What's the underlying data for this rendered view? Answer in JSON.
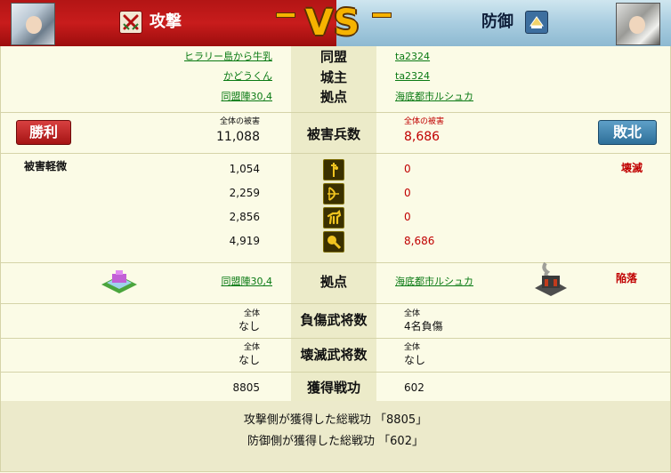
{
  "header": {
    "attack_label": "攻撃",
    "defense_label": "防御",
    "vs_text": "VS",
    "attack_color": "#c81c1c",
    "defense_color": "#a9cde0"
  },
  "info_rows": [
    {
      "label": "同盟",
      "attacker": "ヒラリー島から牛乳",
      "defender": "ta2324"
    },
    {
      "label": "城主",
      "attacker": "かどうくん",
      "defender": "ta2324"
    },
    {
      "label": "拠点",
      "attacker": "同盟陣30,4",
      "defender": "海底都市ルシュカ"
    }
  ],
  "damage": {
    "label": "被害兵数",
    "attacker_caption": "全体の被害",
    "attacker_total": "11,088",
    "defender_caption": "全体の被害",
    "defender_total": "8,686",
    "attacker_result": "勝利",
    "defender_result": "敗北",
    "attacker_status": "被害軽微",
    "defender_status": "壊滅"
  },
  "units": [
    {
      "icon": "spearman-icon",
      "attacker": "1,054",
      "defender": "0"
    },
    {
      "icon": "archer-icon",
      "attacker": "2,259",
      "defender": "0"
    },
    {
      "icon": "cavalry-icon",
      "attacker": "2,856",
      "defender": "0"
    },
    {
      "icon": "siege-icon",
      "attacker": "4,919",
      "defender": "8,686"
    }
  ],
  "base": {
    "label": "拠点",
    "attacker": "同盟陣30,4",
    "defender": "海底都市ルシュカ",
    "defender_status": "陥落"
  },
  "wounded": {
    "label": "負傷武将数",
    "attacker_caption": "全体",
    "attacker_value": "なし",
    "defender_caption": "全体",
    "defender_value": "4名負傷"
  },
  "destroyed": {
    "label": "壊滅武将数",
    "attacker_caption": "全体",
    "attacker_value": "なし",
    "defender_caption": "全体",
    "defender_value": "なし"
  },
  "merit": {
    "label": "獲得戦功",
    "attacker_value": "8805",
    "defender_value": "602"
  },
  "summary": [
    "攻撃側が獲得した総戦功 「8805」",
    "防御側が獲得した総戦功 「602」"
  ]
}
